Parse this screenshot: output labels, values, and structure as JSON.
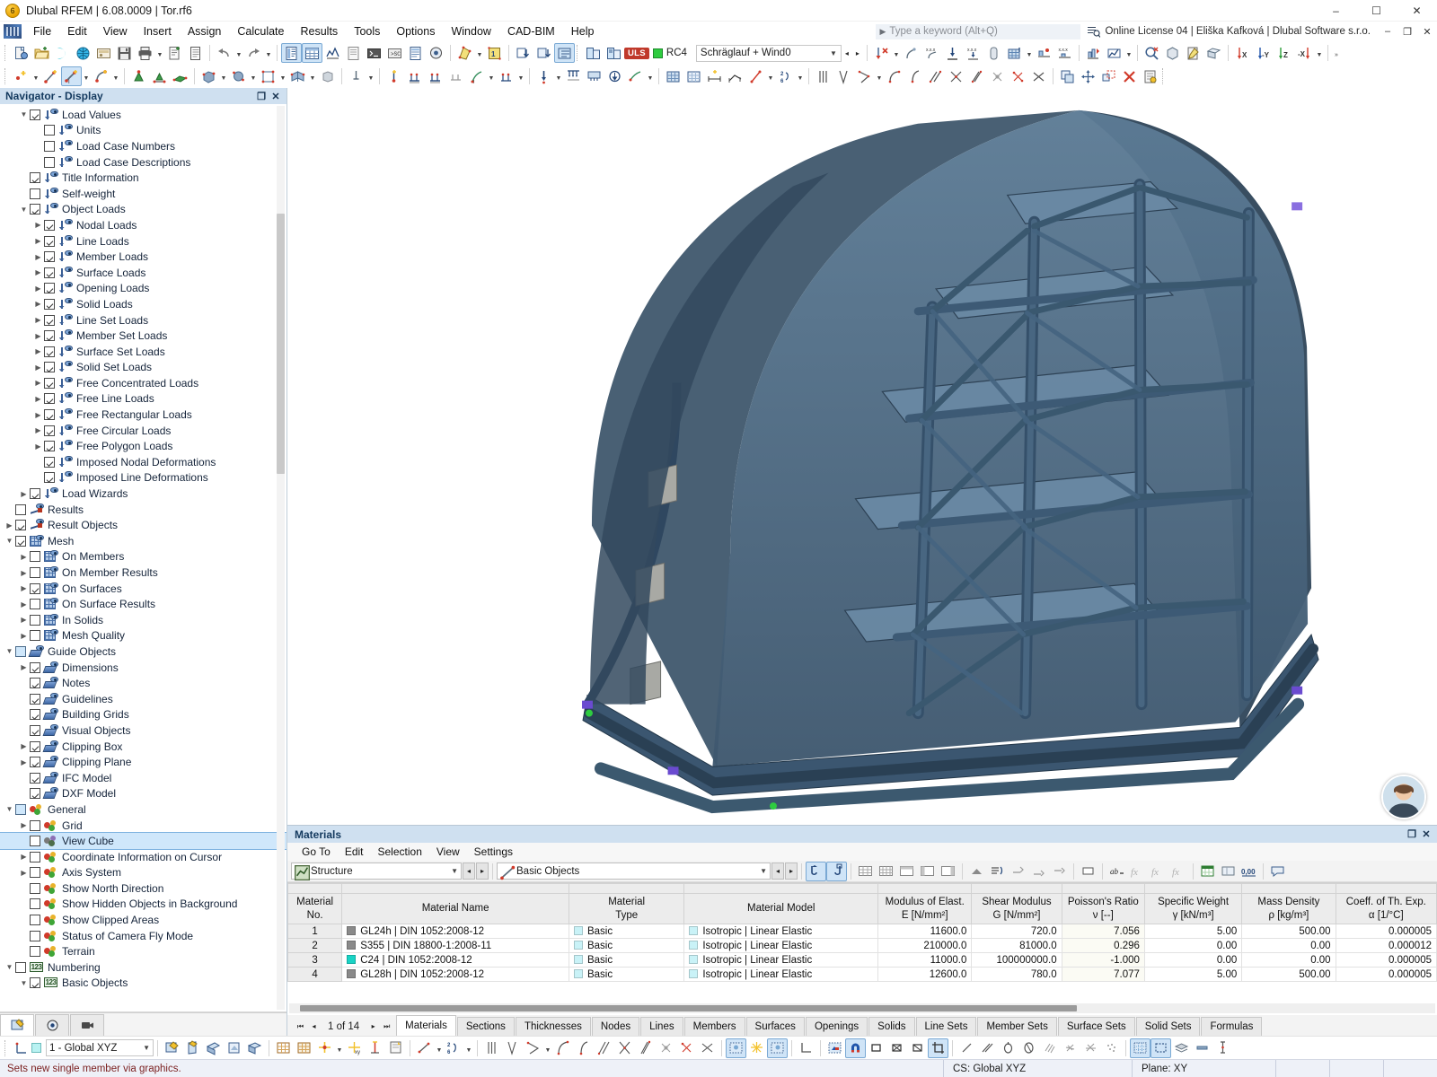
{
  "window": {
    "title": "Dlubal RFEM | 6.08.0009 | Tor.rf6",
    "minimize": "–",
    "maximize": "☐",
    "close": "✕"
  },
  "menubar": {
    "items": [
      "File",
      "Edit",
      "View",
      "Insert",
      "Assign",
      "Calculate",
      "Results",
      "Tools",
      "Options",
      "Window",
      "CAD-BIM",
      "Help"
    ],
    "search_placeholder": "Type a keyword (Alt+Q)",
    "license": "Online License 04 | Eliška Kafková | Dlubal Software s.r.o.",
    "minimize": "–",
    "restore": "❐",
    "close": "✕"
  },
  "toolbar": {
    "design_situation": "ULS",
    "result_combination": "RC4",
    "load_case": "Schräglauf + Wind0",
    "prev": "◂",
    "next": "▸",
    "overflow": "»"
  },
  "navigator": {
    "title": "Navigator - Display",
    "float_btn": "❐",
    "close_btn": "✕",
    "items": [
      {
        "label": "Load Values",
        "indent": 2,
        "checked": true,
        "expander": "down",
        "icon": "load-icon"
      },
      {
        "label": "Units",
        "indent": 3,
        "checked": false,
        "expander": "none",
        "icon": "load-icon"
      },
      {
        "label": "Load Case Numbers",
        "indent": 3,
        "checked": false,
        "expander": "none",
        "icon": "load-icon"
      },
      {
        "label": "Load Case Descriptions",
        "indent": 3,
        "checked": false,
        "expander": "none",
        "icon": "load-icon"
      },
      {
        "label": "Title Information",
        "indent": 2,
        "checked": true,
        "expander": "none",
        "icon": "load-icon"
      },
      {
        "label": "Self-weight",
        "indent": 2,
        "checked": false,
        "expander": "none",
        "icon": "load-icon"
      },
      {
        "label": "Object Loads",
        "indent": 2,
        "checked": true,
        "expander": "down",
        "icon": "load-icon"
      },
      {
        "label": "Nodal Loads",
        "indent": 3,
        "checked": true,
        "expander": "right",
        "icon": "load-icon"
      },
      {
        "label": "Line Loads",
        "indent": 3,
        "checked": true,
        "expander": "right",
        "icon": "load-icon"
      },
      {
        "label": "Member Loads",
        "indent": 3,
        "checked": true,
        "expander": "right",
        "icon": "load-icon"
      },
      {
        "label": "Surface Loads",
        "indent": 3,
        "checked": true,
        "expander": "right",
        "icon": "load-icon"
      },
      {
        "label": "Opening Loads",
        "indent": 3,
        "checked": true,
        "expander": "right",
        "icon": "load-icon"
      },
      {
        "label": "Solid Loads",
        "indent": 3,
        "checked": true,
        "expander": "right",
        "icon": "load-icon"
      },
      {
        "label": "Line Set Loads",
        "indent": 3,
        "checked": true,
        "expander": "right",
        "icon": "load-icon"
      },
      {
        "label": "Member Set Loads",
        "indent": 3,
        "checked": true,
        "expander": "right",
        "icon": "load-icon"
      },
      {
        "label": "Surface Set Loads",
        "indent": 3,
        "checked": true,
        "expander": "right",
        "icon": "load-icon"
      },
      {
        "label": "Solid Set Loads",
        "indent": 3,
        "checked": true,
        "expander": "right",
        "icon": "load-icon"
      },
      {
        "label": "Free Concentrated Loads",
        "indent": 3,
        "checked": true,
        "expander": "right",
        "icon": "load-icon"
      },
      {
        "label": "Free Line Loads",
        "indent": 3,
        "checked": true,
        "expander": "right",
        "icon": "load-icon"
      },
      {
        "label": "Free Rectangular Loads",
        "indent": 3,
        "checked": true,
        "expander": "right",
        "icon": "load-icon"
      },
      {
        "label": "Free Circular Loads",
        "indent": 3,
        "checked": true,
        "expander": "right",
        "icon": "load-icon"
      },
      {
        "label": "Free Polygon Loads",
        "indent": 3,
        "checked": true,
        "expander": "right",
        "icon": "load-icon"
      },
      {
        "label": "Imposed Nodal Deformations",
        "indent": 3,
        "checked": true,
        "expander": "none",
        "icon": "load-icon"
      },
      {
        "label": "Imposed Line Deformations",
        "indent": 3,
        "checked": true,
        "expander": "none",
        "icon": "load-icon"
      },
      {
        "label": "Load Wizards",
        "indent": 2,
        "checked": true,
        "expander": "right",
        "icon": "load-icon"
      },
      {
        "label": "Results",
        "indent": 1,
        "checked": false,
        "expander": "none",
        "icon": "results-icon"
      },
      {
        "label": "Result Objects",
        "indent": 1,
        "checked": true,
        "expander": "right",
        "icon": "results-icon"
      },
      {
        "label": "Mesh",
        "indent": 1,
        "checked": true,
        "expander": "down",
        "icon": "mesh-icon"
      },
      {
        "label": "On Members",
        "indent": 2,
        "checked": false,
        "expander": "right",
        "icon": "mesh-icon"
      },
      {
        "label": "On Member Results",
        "indent": 2,
        "checked": false,
        "expander": "right",
        "icon": "mesh-icon"
      },
      {
        "label": "On Surfaces",
        "indent": 2,
        "checked": true,
        "expander": "right",
        "icon": "mesh-icon"
      },
      {
        "label": "On Surface Results",
        "indent": 2,
        "checked": false,
        "expander": "right",
        "icon": "mesh-icon"
      },
      {
        "label": "In Solids",
        "indent": 2,
        "checked": false,
        "expander": "right",
        "icon": "mesh-icon"
      },
      {
        "label": "Mesh Quality",
        "indent": 2,
        "checked": false,
        "expander": "right",
        "icon": "mesh-icon"
      },
      {
        "label": "Guide Objects",
        "indent": 1,
        "checked": "tri",
        "expander": "down",
        "icon": "guide-icon"
      },
      {
        "label": "Dimensions",
        "indent": 2,
        "checked": true,
        "expander": "right",
        "icon": "guide-icon"
      },
      {
        "label": "Notes",
        "indent": 2,
        "checked": true,
        "expander": "none",
        "icon": "guide-icon"
      },
      {
        "label": "Guidelines",
        "indent": 2,
        "checked": true,
        "expander": "none",
        "icon": "guide-icon"
      },
      {
        "label": "Building Grids",
        "indent": 2,
        "checked": true,
        "expander": "none",
        "icon": "guide-icon"
      },
      {
        "label": "Visual Objects",
        "indent": 2,
        "checked": true,
        "expander": "none",
        "icon": "guide-icon"
      },
      {
        "label": "Clipping Box",
        "indent": 2,
        "checked": true,
        "expander": "right",
        "icon": "guide-icon"
      },
      {
        "label": "Clipping Plane",
        "indent": 2,
        "checked": true,
        "expander": "right",
        "icon": "guide-icon"
      },
      {
        "label": "IFC Model",
        "indent": 2,
        "checked": true,
        "expander": "none",
        "icon": "guide-icon"
      },
      {
        "label": "DXF Model",
        "indent": 2,
        "checked": true,
        "expander": "none",
        "icon": "guide-icon"
      },
      {
        "label": "General",
        "indent": 1,
        "checked": "tri",
        "expander": "down",
        "icon": "general-icon"
      },
      {
        "label": "Grid",
        "indent": 2,
        "checked": false,
        "expander": "right",
        "icon": "general-icon"
      },
      {
        "label": "View Cube",
        "indent": 2,
        "checked": false,
        "expander": "none",
        "icon": "general-icon-gray",
        "selected": true
      },
      {
        "label": "Coordinate Information on Cursor",
        "indent": 2,
        "checked": false,
        "expander": "right",
        "icon": "general-icon"
      },
      {
        "label": "Axis System",
        "indent": 2,
        "checked": false,
        "expander": "right",
        "icon": "general-icon"
      },
      {
        "label": "Show North Direction",
        "indent": 2,
        "checked": false,
        "expander": "none",
        "icon": "general-icon"
      },
      {
        "label": "Show Hidden Objects in Background",
        "indent": 2,
        "checked": false,
        "expander": "none",
        "icon": "general-icon"
      },
      {
        "label": "Show Clipped Areas",
        "indent": 2,
        "checked": false,
        "expander": "none",
        "icon": "general-icon"
      },
      {
        "label": "Status of Camera Fly Mode",
        "indent": 2,
        "checked": false,
        "expander": "none",
        "icon": "general-icon"
      },
      {
        "label": "Terrain",
        "indent": 2,
        "checked": false,
        "expander": "none",
        "icon": "general-icon"
      },
      {
        "label": "Numbering",
        "indent": 1,
        "checked": false,
        "expander": "down",
        "icon": "numbering-icon"
      },
      {
        "label": "Basic Objects",
        "indent": 2,
        "checked": true,
        "expander": "down",
        "icon": "numbering-icon"
      }
    ]
  },
  "materials_panel": {
    "title": "Materials",
    "float_btn": "❐",
    "close_btn": "✕",
    "menu": [
      "Go To",
      "Edit",
      "Selection",
      "View",
      "Settings"
    ],
    "combo_structure": "Structure",
    "combo_objects": "Basic Objects",
    "chev": "⌄",
    "prev": "◂",
    "next": "▸",
    "columns": [
      {
        "line1": "Material",
        "line2": "No."
      },
      {
        "line1": "",
        "line2": "Material Name"
      },
      {
        "line1": "Material",
        "line2": "Type"
      },
      {
        "line1": "",
        "line2": "Material Model"
      },
      {
        "line1": "Modulus of Elast.",
        "line2": "E [N/mm²]"
      },
      {
        "line1": "Shear Modulus",
        "line2": "G [N/mm²]"
      },
      {
        "line1": "Poisson's Ratio",
        "line2": "ν [--]"
      },
      {
        "line1": "Specific Weight",
        "line2": "γ [kN/m³]"
      },
      {
        "line1": "Mass Density",
        "line2": "ρ [kg/m³]"
      },
      {
        "line1": "Coeff. of Th. Exp.",
        "line2": "α [1/°C]"
      }
    ],
    "rows": [
      {
        "no": "1",
        "name": "GL24h | DIN 1052:2008-12",
        "name_color": "#8a8a8a",
        "type": "Basic",
        "type_color": "#c9f2f7",
        "model": "Isotropic | Linear Elastic",
        "model_color": "#c9f2f7",
        "E": "11600.0",
        "G": "720.0",
        "nu": "7.056",
        "gamma": "5.00",
        "rho": "500.00",
        "alpha": "0.000005"
      },
      {
        "no": "2",
        "name": "S355 | DIN 18800-1:2008-11",
        "name_color": "#8a8a8a",
        "type": "Basic",
        "type_color": "#c9f2f7",
        "model": "Isotropic | Linear Elastic",
        "model_color": "#c9f2f7",
        "E": "210000.0",
        "G": "81000.0",
        "nu": "0.296",
        "gamma": "0.00",
        "rho": "0.00",
        "alpha": "0.000012"
      },
      {
        "no": "3",
        "name": "C24 | DIN 1052:2008-12",
        "name_color": "#19d3c5",
        "type": "Basic",
        "type_color": "#c9f2f7",
        "model": "Isotropic | Linear Elastic",
        "model_color": "#c9f2f7",
        "E": "11000.0",
        "G": "100000000.0",
        "nu": "-1.000",
        "gamma": "0.00",
        "rho": "0.00",
        "alpha": "0.000005"
      },
      {
        "no": "4",
        "name": "GL28h | DIN 1052:2008-12",
        "name_color": "#8a8a8a",
        "type": "Basic",
        "type_color": "#c9f2f7",
        "model": "Isotropic | Linear Elastic",
        "model_color": "#c9f2f7",
        "E": "12600.0",
        "G": "780.0",
        "nu": "7.077",
        "gamma": "5.00",
        "rho": "500.00",
        "alpha": "0.000005"
      }
    ],
    "pager": {
      "first": "⏮",
      "prev": "◂",
      "text": "1 of 14",
      "next": "▸",
      "last": "⏭"
    },
    "tabs": [
      "Materials",
      "Sections",
      "Thicknesses",
      "Nodes",
      "Lines",
      "Members",
      "Surfaces",
      "Openings",
      "Solids",
      "Line Sets",
      "Member Sets",
      "Surface Sets",
      "Solid Sets",
      "Formulas"
    ],
    "active_tab": "Materials"
  },
  "bottombar": {
    "coordinate_system": "1 - Global XYZ",
    "chev": "⌄"
  },
  "statusbar": {
    "message": "Sets new single member via graphics.",
    "cs": "CS: Global XYZ",
    "plane": "Plane: XY"
  }
}
